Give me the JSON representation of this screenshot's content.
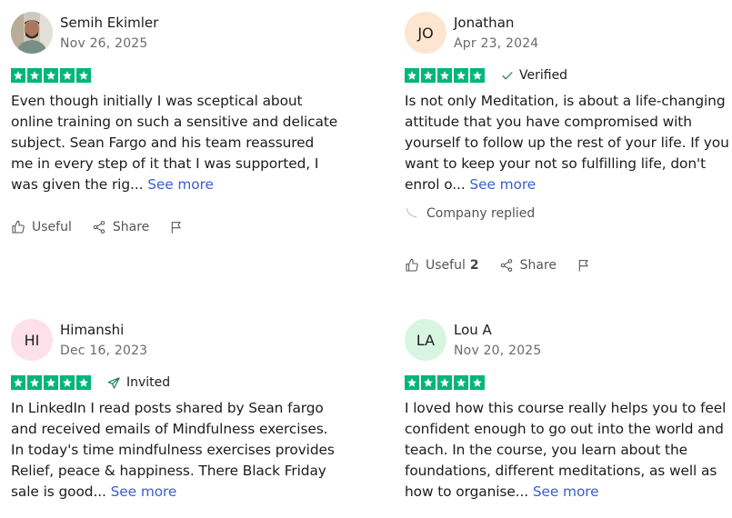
{
  "reviews": [
    {
      "name": "Semih Ekimler",
      "date": "Nov 26, 2025",
      "initials": "",
      "avatar_color": "#d9d4cc",
      "body": "Even though initially I was sceptical about online training on such a sensitive and delicate subject. Sean Fargo and his team reassured me in every step of it that I was supported, I was given the rig... ",
      "see_more": "See more",
      "useful": "Useful",
      "useful_count": "",
      "share": "Share"
    },
    {
      "name": "Jonathan",
      "date": "Apr 23, 2024",
      "initials": "JO",
      "avatar_color": "#fde5cf",
      "badge": "Verified",
      "body": "Is not only Meditation, is about a life-changing attitude that you have compromised with yourself to follow up the rest of your life. If you want to keep your not so fulfilling life, don't enrol o... ",
      "see_more": "See more",
      "company_replied": "Company replied",
      "useful": "Useful",
      "useful_count": "2",
      "share": "Share"
    },
    {
      "name": "Himanshi",
      "date": "Dec 16, 2023",
      "initials": "HI",
      "avatar_color": "#fde0ea",
      "badge": "Invited",
      "body": "In LinkedIn I read posts shared by Sean fargo and received emails of Mindfulness exercises. In today's time mindfulness exercises provides Relief, peace & happiness. There Black Friday sale is good... ",
      "see_more": "See more"
    },
    {
      "name": "Lou A",
      "date": "Nov 20, 2025",
      "initials": "LA",
      "avatar_color": "#d8f5e1",
      "body": "I loved how this course really helps you to feel confident enough to go out into the world and teach. In the course, you learn about the foundations, different meditations, as well as how to organise... ",
      "see_more": "See more"
    }
  ],
  "rating_stars": 5,
  "colors": {
    "star_green": "#00b67a",
    "link_blue": "#3a5fcd",
    "badge_green": "#1b7a4f"
  },
  "icons": [
    "star-icon",
    "verified-check-icon",
    "invited-send-icon",
    "reply-corner-icon",
    "thumbs-up-icon",
    "share-icon",
    "flag-icon"
  ]
}
